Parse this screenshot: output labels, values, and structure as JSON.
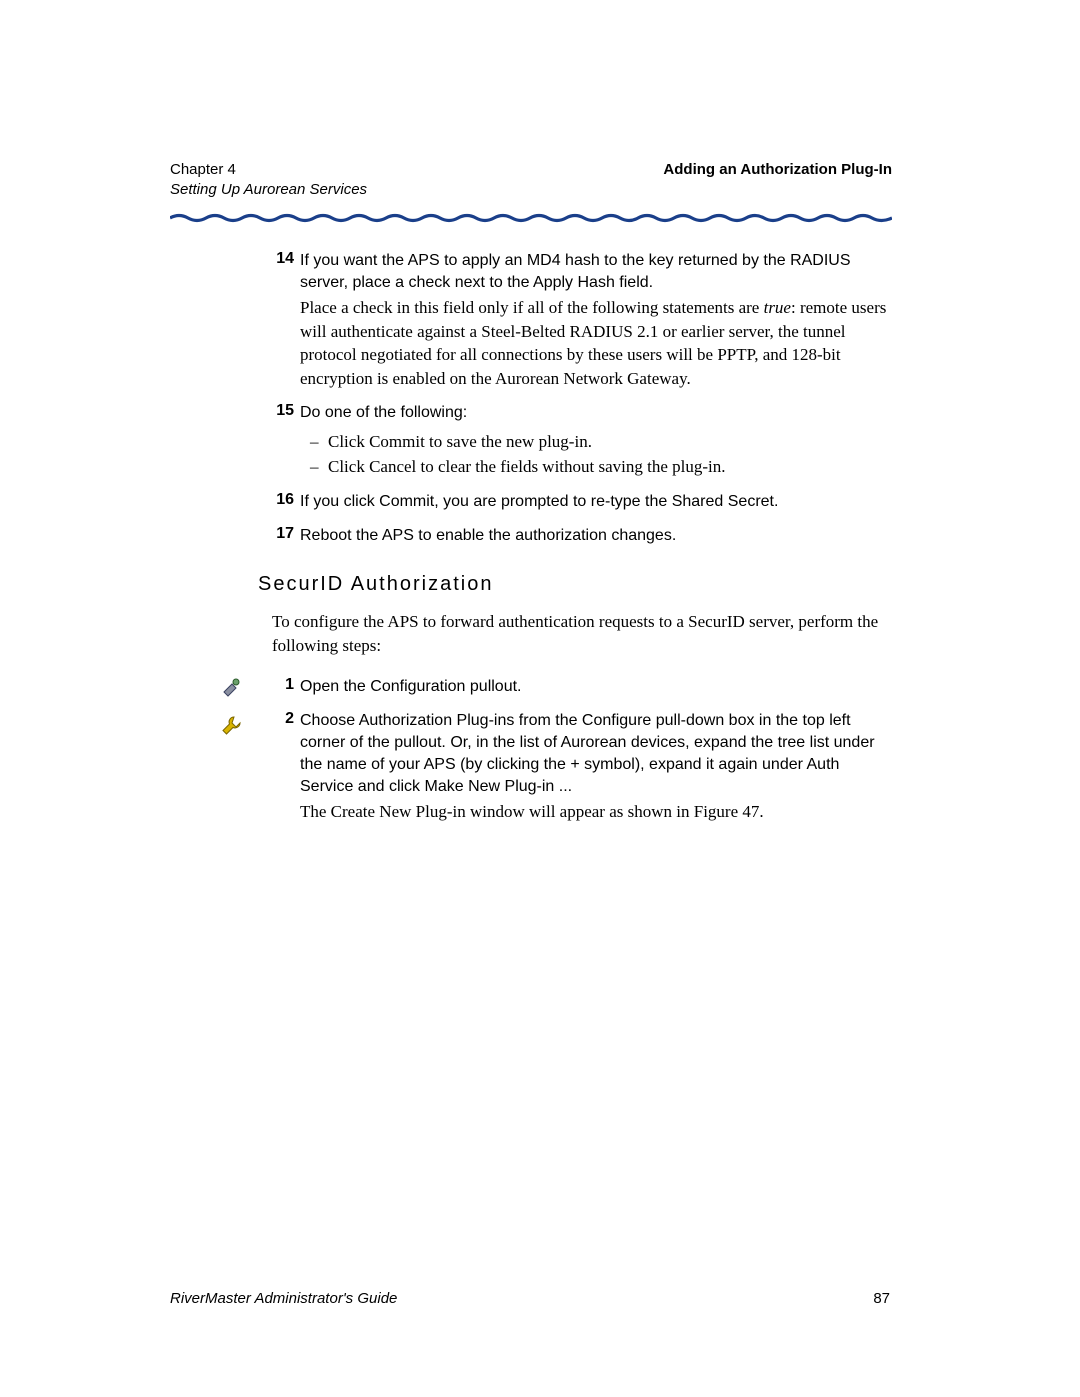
{
  "header": {
    "chapter": "Chapter 4",
    "subtitle": "Setting Up Aurorean Services",
    "right": "Adding an Authorization Plug-In"
  },
  "items": {
    "i14": {
      "num": "14",
      "lead": "If you want the APS to apply an MD4 hash to the key returned by the RADIUS server, place a check next to the Apply Hash field.",
      "body_prefix": "Place a check in this field only if all of the following statements are ",
      "body_italic": "true",
      "body_suffix": ": remote users will authenticate against a Steel-Belted RADIUS 2.1 or earlier server, the tunnel protocol negotiated for all connections by these users will be PPTP, and 128-bit encryption is enabled on the Aurorean Network Gateway."
    },
    "i15": {
      "num": "15",
      "lead": "Do one of the following:",
      "sub1": "Click Commit to save the new plug-in.",
      "sub2": "Click Cancel to clear the fields without saving the plug-in."
    },
    "i16": {
      "num": "16",
      "lead": "If you click Commit, you are prompted to re-type the Shared Secret."
    },
    "i17": {
      "num": "17",
      "lead": "Reboot the APS to enable the authorization changes."
    }
  },
  "section": {
    "heading": "SecurID Authorization",
    "intro": "To configure the APS to forward authentication requests to a SecurID server, perform the following steps:"
  },
  "steps": {
    "s1": {
      "num": "1",
      "lead": "Open the Configuration pullout."
    },
    "s2": {
      "num": "2",
      "lead": "Choose Authorization Plug-ins from the Configure pull-down box in the top left corner of the pullout. Or, in the list of Aurorean devices, expand the tree list under the name of your APS (by clicking the + symbol), expand it again under Auth Service and click Make New Plug-in ...",
      "body": "The Create New Plug-in window will appear as shown in Figure 47."
    }
  },
  "footer": {
    "left": "RiverMaster Administrator's Guide",
    "page": "87"
  },
  "colors": {
    "wave": "#1a3f8a"
  }
}
